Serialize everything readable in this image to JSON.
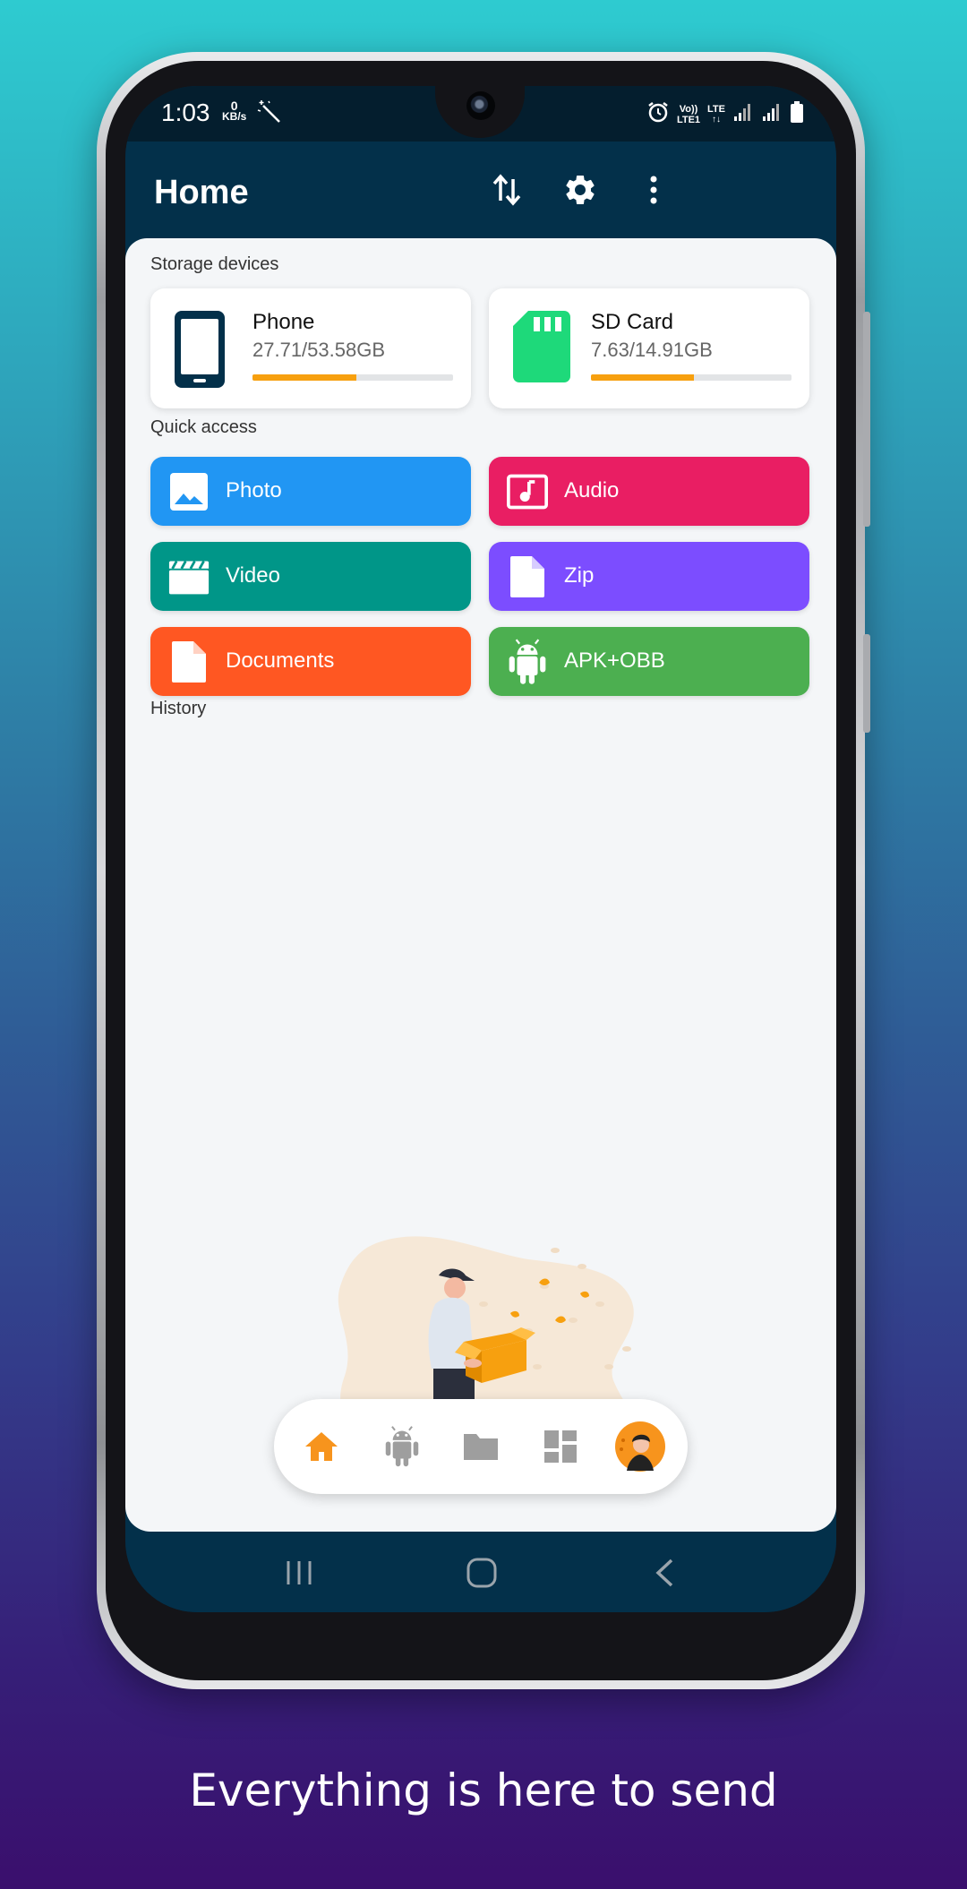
{
  "status_bar": {
    "time": "1:03",
    "net_speed_value": "0",
    "net_speed_unit": "KB/s",
    "volte_label": "Vo))",
    "lte1_label": "LTE1",
    "lte_label": "LTE"
  },
  "app_bar": {
    "title": "Home",
    "actions": [
      "transfer-arrows-icon",
      "settings-gear-icon",
      "more-vert-icon"
    ]
  },
  "storage": {
    "section_label": "Storage devices",
    "devices": [
      {
        "name": "Phone",
        "size": "27.71/53.58GB",
        "used_fraction": 0.517,
        "icon": "phone-icon",
        "icon_color": "#03304a"
      },
      {
        "name": "SD Card",
        "size": "7.63/14.91GB",
        "used_fraction": 0.512,
        "icon": "sd-card-icon",
        "icon_color": "#1ed97a"
      }
    ]
  },
  "quick_access": {
    "section_label": "Quick access",
    "items": [
      {
        "label": "Photo",
        "icon": "photo-icon",
        "color": "#2196f3"
      },
      {
        "label": "Audio",
        "icon": "audio-icon",
        "color": "#e91e63"
      },
      {
        "label": "Video",
        "icon": "video-clapper-icon",
        "color": "#009688"
      },
      {
        "label": "Zip",
        "icon": "zip-file-icon",
        "color": "#7c4dff"
      },
      {
        "label": "Documents",
        "icon": "document-icon",
        "color": "#ff5722"
      },
      {
        "label": "APK+OBB",
        "icon": "android-icon",
        "color": "#4caf50"
      }
    ]
  },
  "history": {
    "section_label": "History"
  },
  "bottom_nav": {
    "items": [
      "home-icon",
      "android-icon",
      "folder-icon",
      "dashboard-icon",
      "profile-avatar"
    ],
    "active": "home-icon",
    "active_color": "#f7941d"
  },
  "system_nav": [
    "recents-icon",
    "home-icon",
    "back-icon"
  ],
  "tagline": "Everything is here to send"
}
